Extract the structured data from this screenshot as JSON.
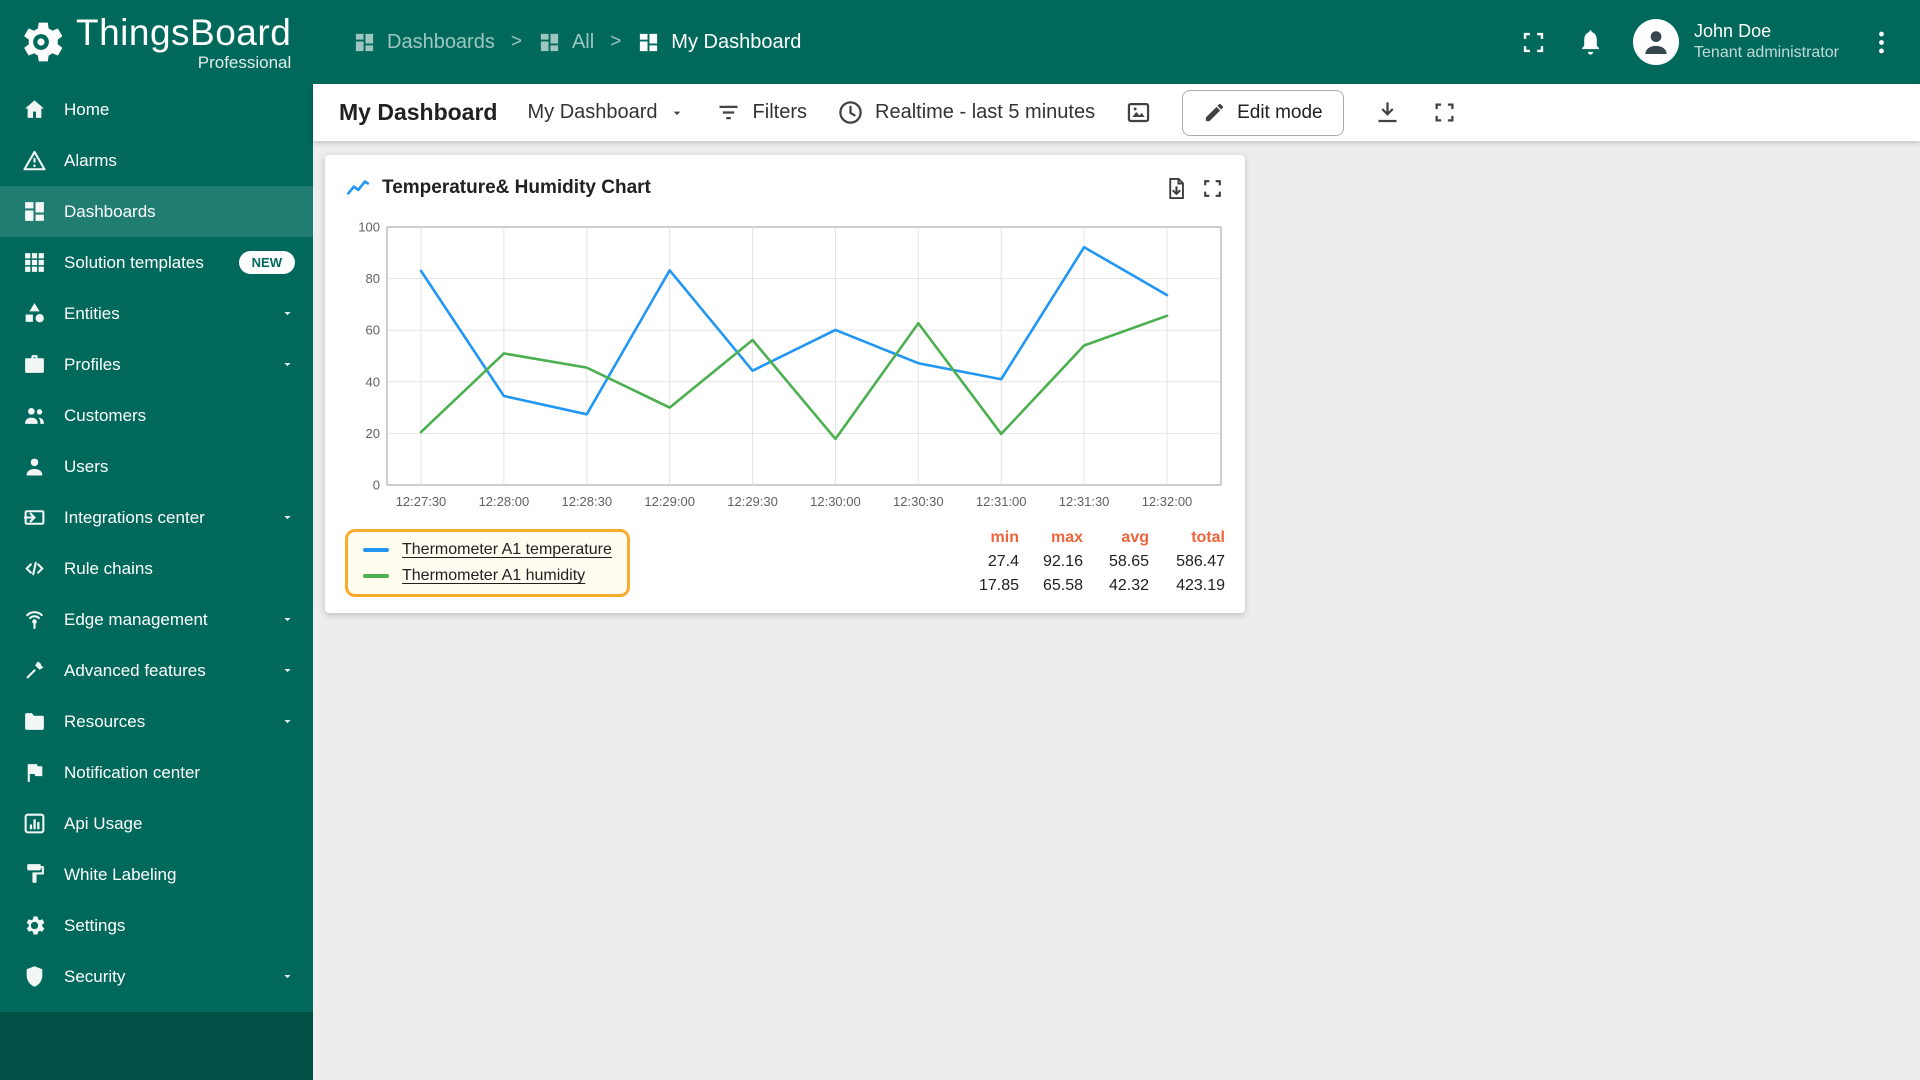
{
  "app": {
    "name": "ThingsBoard",
    "edition": "Professional",
    "user": {
      "name": "John Doe",
      "role": "Tenant administrator"
    }
  },
  "header": {
    "breadcrumb": {
      "separator": ">",
      "items": [
        {
          "label": "Dashboards"
        },
        {
          "label": "All"
        },
        {
          "label": "My Dashboard"
        }
      ]
    }
  },
  "sidebar": {
    "items": [
      {
        "label": "Home"
      },
      {
        "label": "Alarms"
      },
      {
        "label": "Dashboards",
        "active": true
      },
      {
        "label": "Solution templates",
        "badge": "NEW"
      },
      {
        "label": "Entities"
      },
      {
        "label": "Profiles"
      },
      {
        "label": "Customers"
      },
      {
        "label": "Users"
      },
      {
        "label": "Integrations center"
      },
      {
        "label": "Rule chains"
      },
      {
        "label": "Edge management"
      },
      {
        "label": "Advanced features"
      },
      {
        "label": "Resources"
      },
      {
        "label": "Notification center"
      },
      {
        "label": "Api Usage"
      },
      {
        "label": "White Labeling"
      },
      {
        "label": "Settings"
      },
      {
        "label": "Security"
      }
    ]
  },
  "toolbar": {
    "title": "My Dashboard",
    "state_selector": "My Dashboard",
    "filters_label": "Filters",
    "timewindow": "Realtime - last 5 minutes",
    "edit_button": "Edit mode"
  },
  "widget": {
    "title": "Temperature& Humidity Chart",
    "highlight_color": "#fbab2c",
    "legend": [
      {
        "label": "Thermometer A1 temperature",
        "color": "#2196f3"
      },
      {
        "label": "Thermometer A1 humidity",
        "color": "#4caf50"
      }
    ],
    "stats": {
      "headers": [
        "min",
        "max",
        "avg",
        "total"
      ],
      "rows": [
        [
          "27.4",
          "92.16",
          "58.65",
          "586.47"
        ],
        [
          "17.85",
          "65.58",
          "42.32",
          "423.19"
        ]
      ]
    }
  },
  "chart_data": {
    "type": "line",
    "title": "Temperature& Humidity Chart",
    "x": [
      "12:27:30",
      "12:28:00",
      "12:28:30",
      "12:29:00",
      "12:29:30",
      "12:30:00",
      "12:30:30",
      "12:31:00",
      "12:31:30",
      "12:32:00"
    ],
    "series": [
      {
        "name": "Thermometer A1 temperature",
        "color": "#2196f3",
        "values": [
          83,
          34.5,
          27.4,
          83.2,
          44.3,
          60.1,
          47.2,
          41,
          92.16,
          73.61
        ]
      },
      {
        "name": "Thermometer A1 humidity",
        "color": "#4caf50",
        "values": [
          20.5,
          51,
          45.5,
          30,
          56.2,
          17.85,
          62.7,
          19.8,
          54.06,
          65.58
        ]
      }
    ],
    "ylim": [
      0,
      100
    ],
    "yticks": [
      0,
      20,
      40,
      60,
      80,
      100
    ],
    "grid": true,
    "legend_position": "bottom-left"
  },
  "colors": {
    "primary": "#00695c",
    "accent_orange": "#f0643c",
    "series_blue": "#2196f3",
    "series_green": "#4caf50"
  }
}
